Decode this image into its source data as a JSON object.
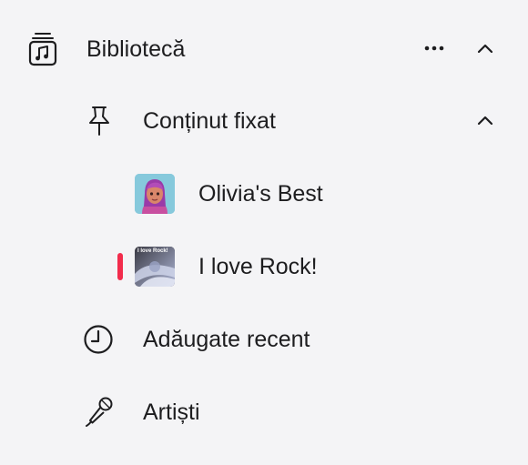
{
  "sidebar": {
    "library": {
      "label": "Bibliotecă",
      "icon": "music-library-icon",
      "more_icon": "more-icon",
      "chevron": "chevron-up-icon"
    },
    "pinned": {
      "label": "Conținut fixat",
      "icon": "pin-icon",
      "chevron": "chevron-up-icon",
      "items": [
        {
          "label": "Olivia's Best",
          "artwork": "playlist-artwork-memoji"
        },
        {
          "label": "I love Rock!",
          "artwork": "playlist-artwork-rock",
          "artwork_text": "I love Rock!",
          "now_playing": true
        }
      ]
    },
    "recently_added": {
      "label": "Adăugate recent",
      "icon": "clock-icon"
    },
    "artists": {
      "label": "Artiști",
      "icon": "microphone-icon"
    }
  },
  "colors": {
    "background": "#f4f4f6",
    "text": "#1d1d1f",
    "accent": "#f22c4c",
    "artwork_memoji_bg": "#7ec3d8",
    "artwork_rock_bg": "#2a2a30"
  }
}
